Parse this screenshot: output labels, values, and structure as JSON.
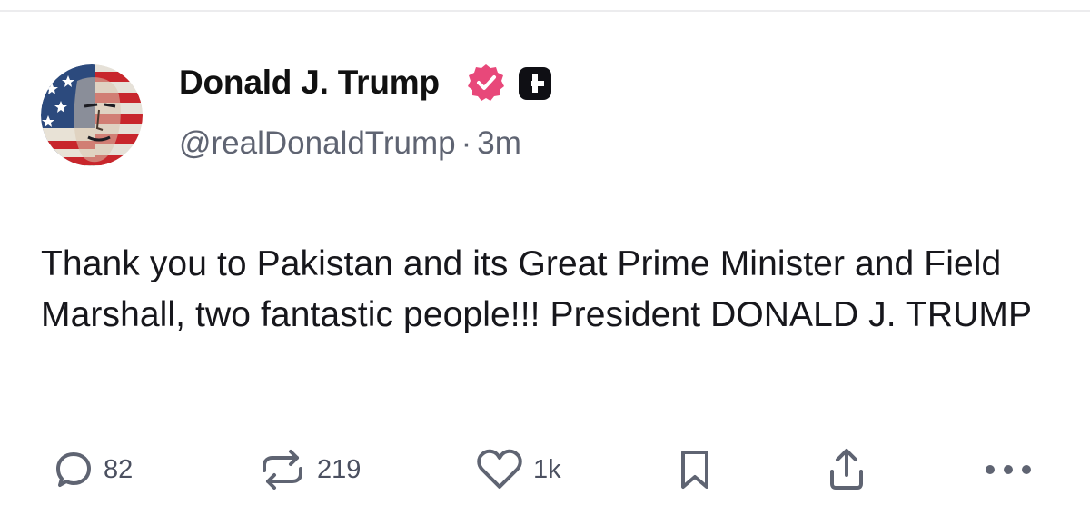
{
  "post": {
    "author": {
      "display_name": "Donald J. Trump",
      "handle": "@realDonaldTrump",
      "verified_icon": "verified-badge-icon",
      "plus_icon": "plus-badge-icon"
    },
    "separator": "·",
    "time_ago": "3m",
    "text": "Thank you to Pakistan and its Great Prime Minister and Field Marshall, two fantastic people!!! President DONALD J. TRUMP"
  },
  "actions": {
    "reply": {
      "icon": "comment-icon",
      "count": "82"
    },
    "repost": {
      "icon": "repost-icon",
      "count": "219"
    },
    "like": {
      "icon": "heart-icon",
      "count": "1k"
    },
    "bookmark": {
      "icon": "bookmark-icon"
    },
    "share": {
      "icon": "share-icon"
    },
    "more": {
      "icon": "more-icon"
    }
  },
  "colors": {
    "verified_badge": "#e8487a",
    "plus_badge": "#0f0f14",
    "icon_gray": "#5f6472",
    "text": "#17171c"
  }
}
